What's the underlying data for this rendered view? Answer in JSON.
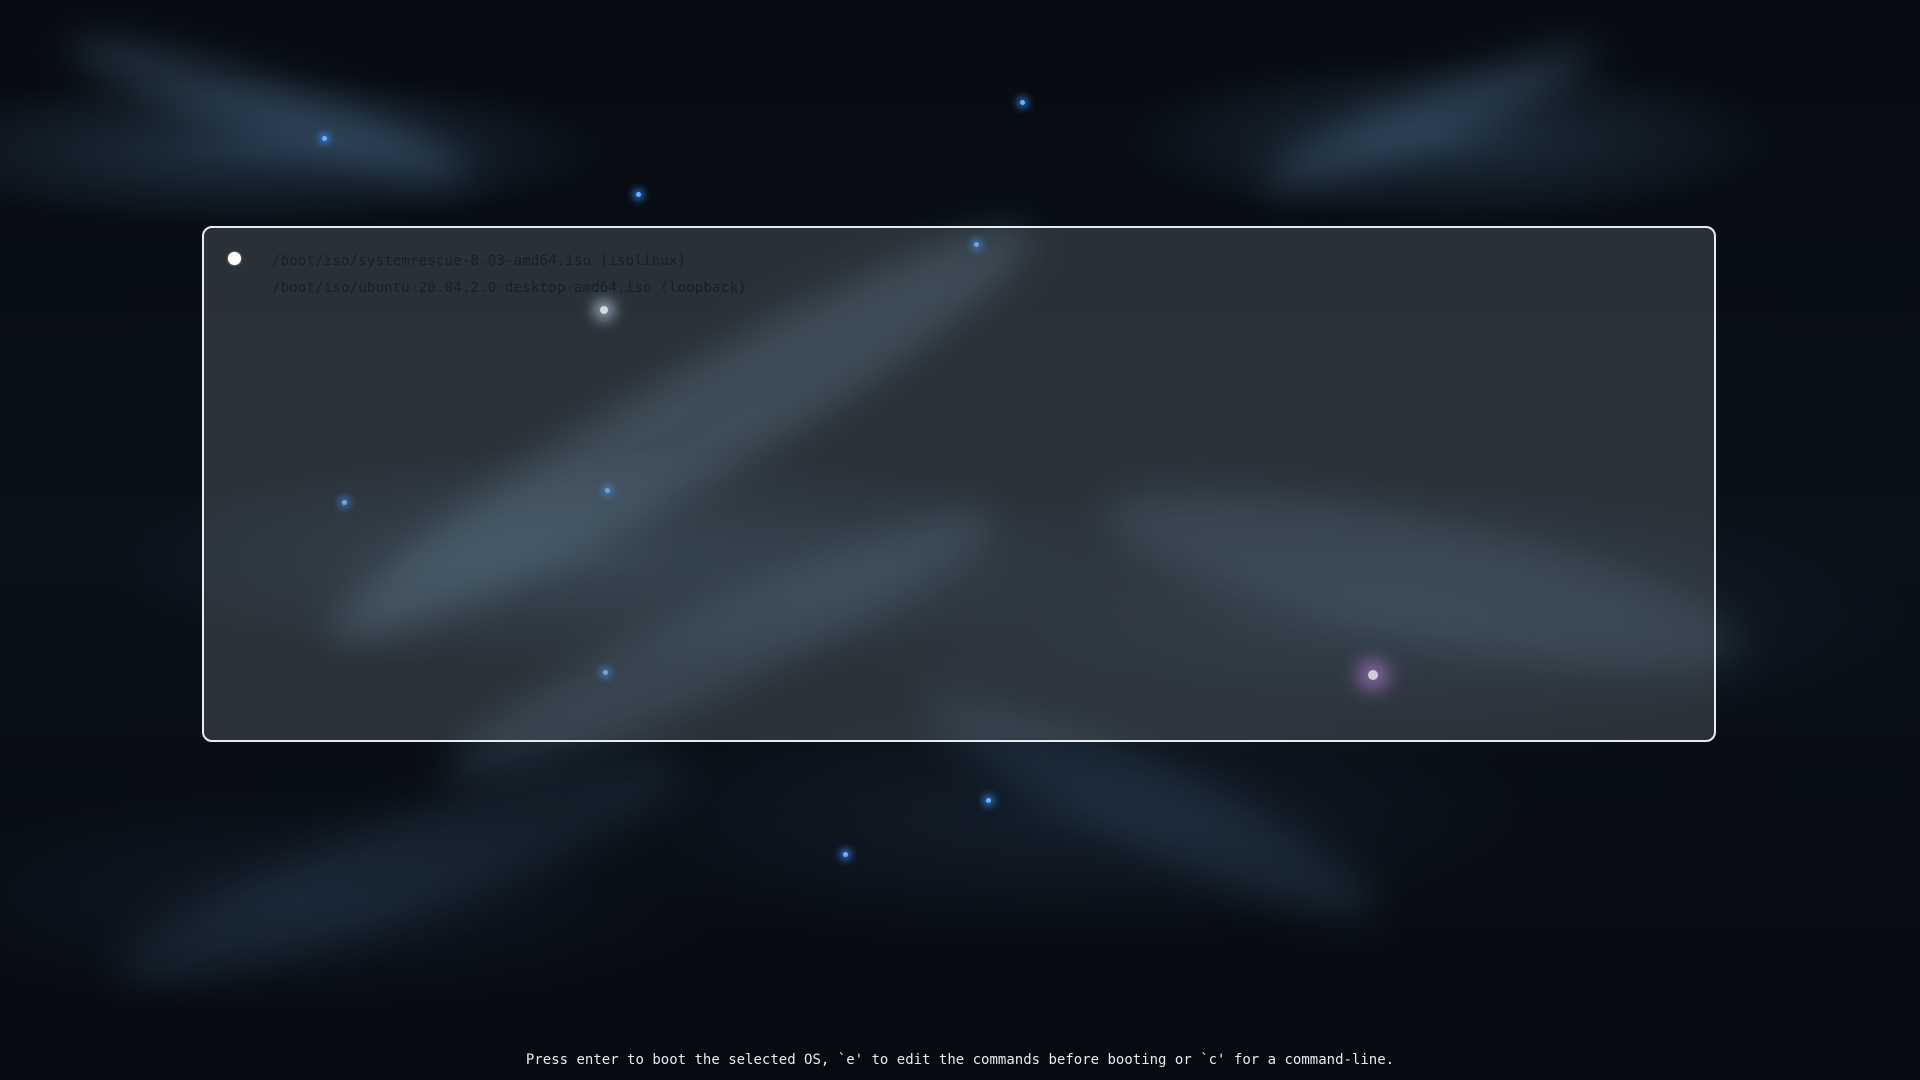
{
  "boot_menu": {
    "entries": [
      {
        "label": "/boot/iso/systemrescue-8.03-amd64.iso (isolinux)",
        "selected": true
      },
      {
        "label": "/boot/iso/ubuntu-20.04.2.0-desktop-amd64.iso (loopback)",
        "selected": false
      }
    ]
  },
  "footer": {
    "help_text": "Press enter to boot the selected OS, `e' to edit the commands before booting or `c' for a command-line."
  },
  "colors": {
    "menu_border": "#e8ecef",
    "entry_text": "#1a1f24",
    "help_text": "#e8ecef",
    "background": "#070b11"
  },
  "icons": {
    "selection_marker": "selected-dot-icon"
  }
}
